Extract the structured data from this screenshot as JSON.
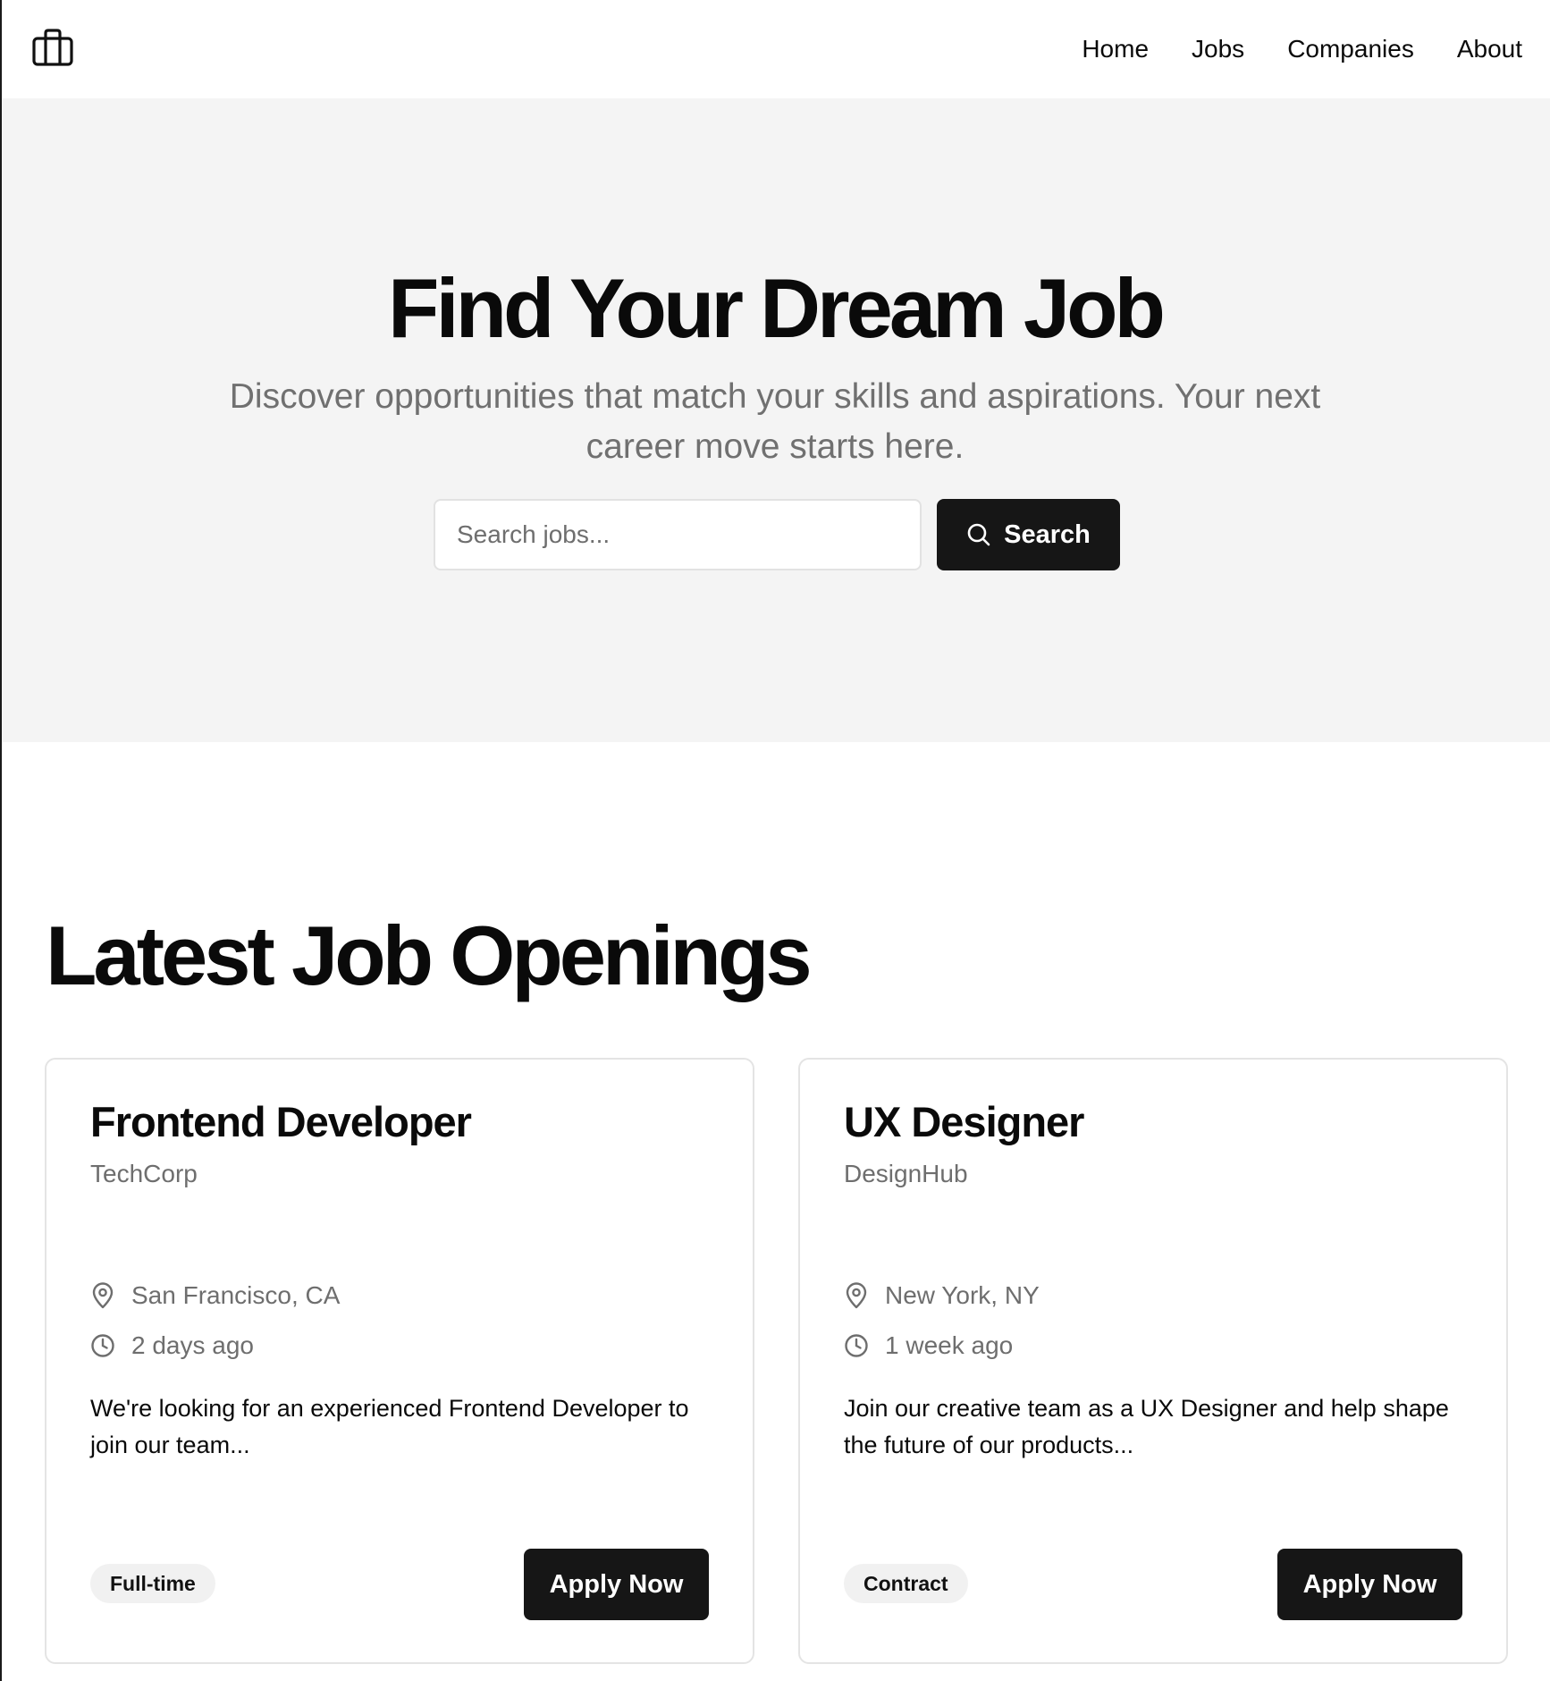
{
  "header": {
    "logo_icon": "briefcase-icon",
    "nav": [
      {
        "label": "Home"
      },
      {
        "label": "Jobs"
      },
      {
        "label": "Companies"
      },
      {
        "label": "About"
      }
    ]
  },
  "hero": {
    "title": "Find Your Dream Job",
    "subtitle": "Discover opportunities that match your skills and aspirations. Your next career move starts here.",
    "search": {
      "placeholder": "Search jobs...",
      "value": "",
      "button_label": "Search",
      "button_icon": "search-icon"
    }
  },
  "jobs_section": {
    "title": "Latest Job Openings",
    "jobs": [
      {
        "title": "Frontend Developer",
        "company": "TechCorp",
        "location": "San Francisco, CA",
        "posted": "2 days ago",
        "description": "We're looking for an experienced Frontend Developer to join our team...",
        "type": "Full-time",
        "apply_label": "Apply Now"
      },
      {
        "title": "UX Designer",
        "company": "DesignHub",
        "location": "New York, NY",
        "posted": "1 week ago",
        "description": "Join our creative team as a UX Designer and help shape the future of our products...",
        "type": "Contract",
        "apply_label": "Apply Now"
      }
    ]
  },
  "colors": {
    "hero_background": "#f4f4f4",
    "button_background": "#161616",
    "muted_text": "#6e6e6e",
    "badge_background": "#f1f1f1"
  }
}
